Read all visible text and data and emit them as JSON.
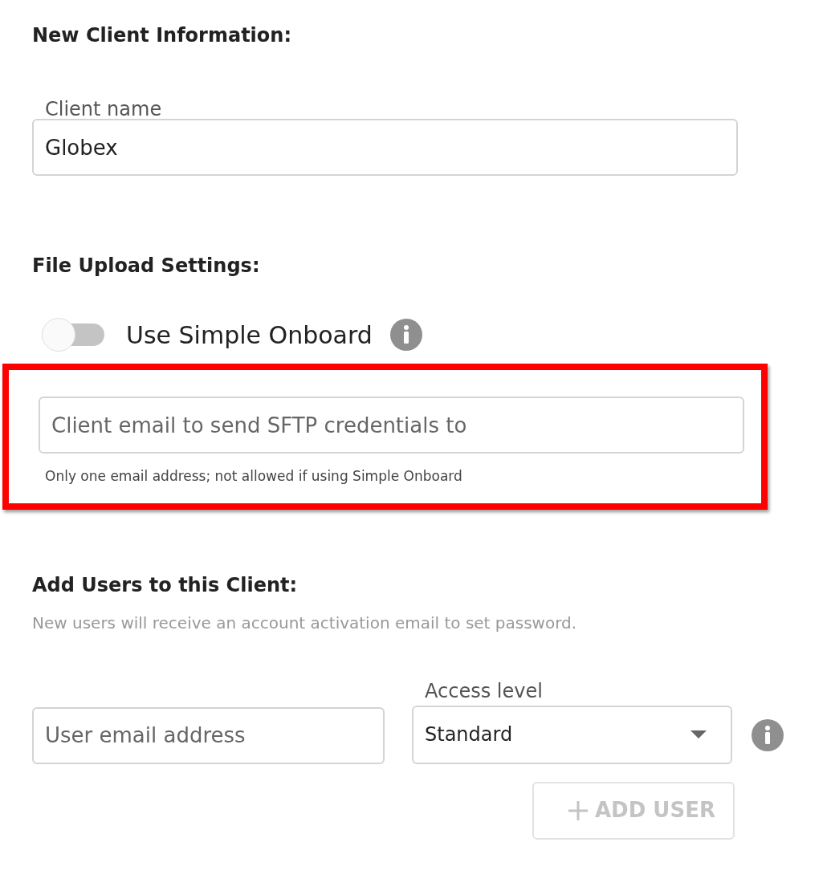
{
  "client_info": {
    "heading": "New Client Information:",
    "name_field": {
      "label": "Client name",
      "value": "Globex"
    }
  },
  "file_upload": {
    "heading": "File Upload Settings:",
    "toggle": {
      "label": "Use Simple Onboard",
      "on": false
    },
    "sftp_email": {
      "placeholder": "Client email to send SFTP credentials to",
      "hint": "Only one email address; not allowed if using Simple Onboard",
      "highlighted": true
    }
  },
  "add_users": {
    "heading": "Add Users to this Client:",
    "description": "New users will receive an account activation email to set password.",
    "email_field": {
      "placeholder": "User email address"
    },
    "access_level": {
      "label": "Access level",
      "value": "Standard"
    },
    "add_button": {
      "label": "ADD USER",
      "disabled": true
    }
  }
}
